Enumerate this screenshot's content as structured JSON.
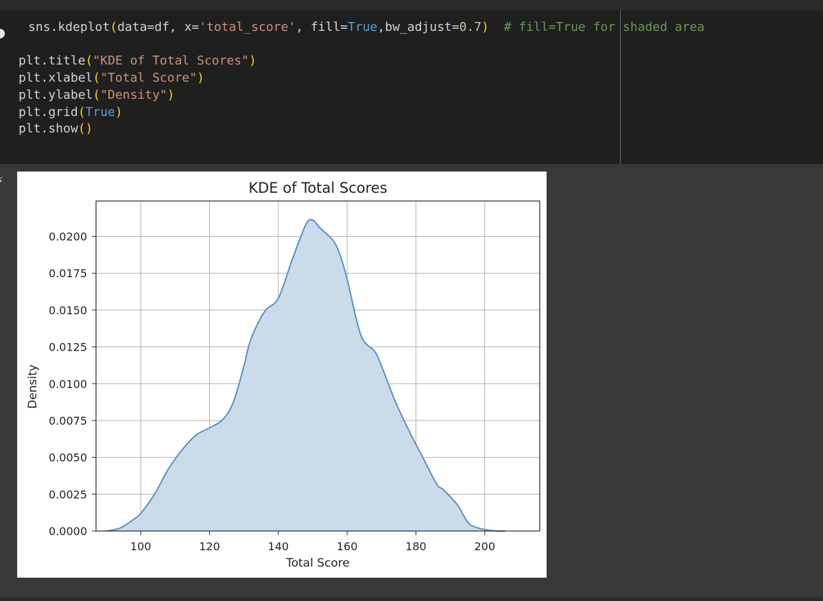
{
  "code": {
    "lines": [
      {
        "segments": [
          {
            "text": "sns.kdeplot",
            "cls": ""
          },
          {
            "text": "(",
            "cls": "p"
          },
          {
            "text": "data=df, x=",
            "cls": ""
          },
          {
            "text": "'total_score'",
            "cls": "s"
          },
          {
            "text": ", fill=",
            "cls": ""
          },
          {
            "text": "True",
            "cls": "k"
          },
          {
            "text": ",bw_adjust=",
            "cls": ""
          },
          {
            "text": "0.7",
            "cls": "n"
          },
          {
            "text": ")",
            "cls": "p"
          },
          {
            "text": "  ",
            "cls": ""
          },
          {
            "text": "# fill=True for shaded area",
            "cls": "c"
          }
        ]
      },
      {
        "segments": []
      },
      {
        "segments": [
          {
            "text": "plt.title",
            "cls": ""
          },
          {
            "text": "(",
            "cls": "p"
          },
          {
            "text": "\"KDE of Total Scores\"",
            "cls": "s"
          },
          {
            "text": ")",
            "cls": "p"
          }
        ]
      },
      {
        "segments": [
          {
            "text": "plt.xlabel",
            "cls": ""
          },
          {
            "text": "(",
            "cls": "p"
          },
          {
            "text": "\"Total Score\"",
            "cls": "s"
          },
          {
            "text": ")",
            "cls": "p"
          }
        ]
      },
      {
        "segments": [
          {
            "text": "plt.ylabel",
            "cls": ""
          },
          {
            "text": "(",
            "cls": "p"
          },
          {
            "text": "\"Density\"",
            "cls": "s"
          },
          {
            "text": ")",
            "cls": "p"
          }
        ]
      },
      {
        "segments": [
          {
            "text": "plt.grid",
            "cls": ""
          },
          {
            "text": "(",
            "cls": "p"
          },
          {
            "text": "True",
            "cls": "k"
          },
          {
            "text": ")",
            "cls": "p"
          }
        ]
      },
      {
        "segments": [
          {
            "text": "plt.show",
            "cls": ""
          },
          {
            "text": "()",
            "cls": "p"
          }
        ]
      }
    ]
  },
  "output": {
    "icon": "output-toggle-icon"
  },
  "colors": {
    "code_background": "#1f1f1f",
    "output_background": "#383838",
    "kde_line": "#5a8fc4",
    "kde_fill": "#c9d9e8",
    "grid": "#b0b0b0"
  },
  "chart_data": {
    "type": "area",
    "title": "KDE of Total Scores",
    "xlabel": "Total Score",
    "ylabel": "Density",
    "xlim": [
      87,
      216
    ],
    "ylim": [
      0,
      0.0224
    ],
    "grid": true,
    "x_ticks": [
      100,
      120,
      140,
      160,
      180,
      200
    ],
    "x_tick_labels": [
      "100",
      "120",
      "140",
      "160",
      "180",
      "200"
    ],
    "y_ticks": [
      0,
      0.0025,
      0.005,
      0.0075,
      0.01,
      0.0125,
      0.015,
      0.0175,
      0.02
    ],
    "y_tick_labels": [
      "0.0000",
      "0.0025",
      "0.0050",
      "0.0075",
      "0.0100",
      "0.0125",
      "0.0150",
      "0.0175",
      "0.0200"
    ],
    "x": [
      90,
      94,
      98,
      100,
      104,
      108,
      112,
      116,
      120,
      124,
      127,
      130,
      132,
      136,
      140,
      144,
      148,
      150,
      152,
      156,
      158,
      160,
      164,
      168,
      170,
      174,
      178,
      182,
      186,
      188,
      192,
      194,
      196,
      200,
      204,
      206
    ],
    "y": [
      0.0,
      0.0002,
      0.0008,
      0.0012,
      0.0025,
      0.0042,
      0.0055,
      0.0065,
      0.007,
      0.0076,
      0.0088,
      0.0112,
      0.013,
      0.0149,
      0.0158,
      0.0184,
      0.0208,
      0.0211,
      0.0206,
      0.0197,
      0.0187,
      0.0171,
      0.0133,
      0.0122,
      0.0112,
      0.0088,
      0.0068,
      0.005,
      0.0032,
      0.0028,
      0.0018,
      0.001,
      0.0004,
      0.0001,
      0.0,
      0.0
    ]
  }
}
